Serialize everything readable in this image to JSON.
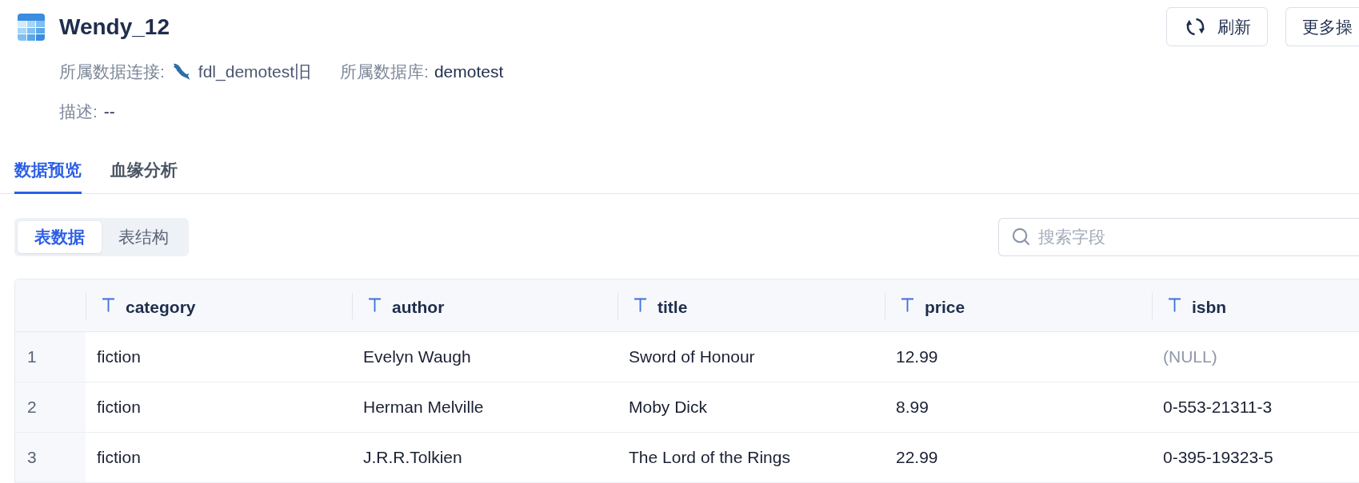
{
  "header": {
    "title": "Wendy_12",
    "meta": [
      {
        "kind": "connection",
        "label": "所属数据连接:",
        "value": "fdl_demotest旧"
      },
      {
        "kind": "database",
        "label": "所属数据库:",
        "value": "demotest"
      }
    ],
    "description": {
      "label": "描述:",
      "value": "--"
    }
  },
  "actions": [
    {
      "kind": "refresh",
      "label": "刷新"
    },
    {
      "kind": "more",
      "label": "更多操"
    }
  ],
  "tabs": [
    {
      "label": "数据预览",
      "selected": true
    },
    {
      "label": "血缘分析",
      "selected": false
    }
  ],
  "view_toggle": [
    {
      "label": "表数据",
      "selected": true
    },
    {
      "label": "表结构",
      "selected": false
    }
  ],
  "search": {
    "placeholder": "搜索字段"
  },
  "table": {
    "columns": [
      {
        "name": "category",
        "kind": "text"
      },
      {
        "name": "author",
        "kind": "text"
      },
      {
        "name": "title",
        "kind": "text"
      },
      {
        "name": "price",
        "kind": "text"
      },
      {
        "name": "isbn",
        "kind": "text"
      }
    ],
    "rows": [
      {
        "index": "1",
        "cells": [
          {
            "text": "fiction",
            "null": false
          },
          {
            "text": "Evelyn Waugh",
            "null": false
          },
          {
            "text": "Sword of Honour",
            "null": false
          },
          {
            "text": "12.99",
            "null": false
          },
          {
            "text": "(NULL)",
            "null": true
          }
        ]
      },
      {
        "index": "2",
        "cells": [
          {
            "text": "fiction",
            "null": false
          },
          {
            "text": "Herman Melville",
            "null": false
          },
          {
            "text": "Moby Dick",
            "null": false
          },
          {
            "text": "8.99",
            "null": false
          },
          {
            "text": "0-553-21311-3",
            "null": false
          }
        ]
      },
      {
        "index": "3",
        "cells": [
          {
            "text": "fiction",
            "null": false
          },
          {
            "text": "J.R.R.Tolkien",
            "null": false
          },
          {
            "text": "The Lord of the Rings",
            "null": false
          },
          {
            "text": "22.99",
            "null": false
          },
          {
            "text": "0-395-19323-5",
            "null": false
          }
        ]
      }
    ]
  }
}
